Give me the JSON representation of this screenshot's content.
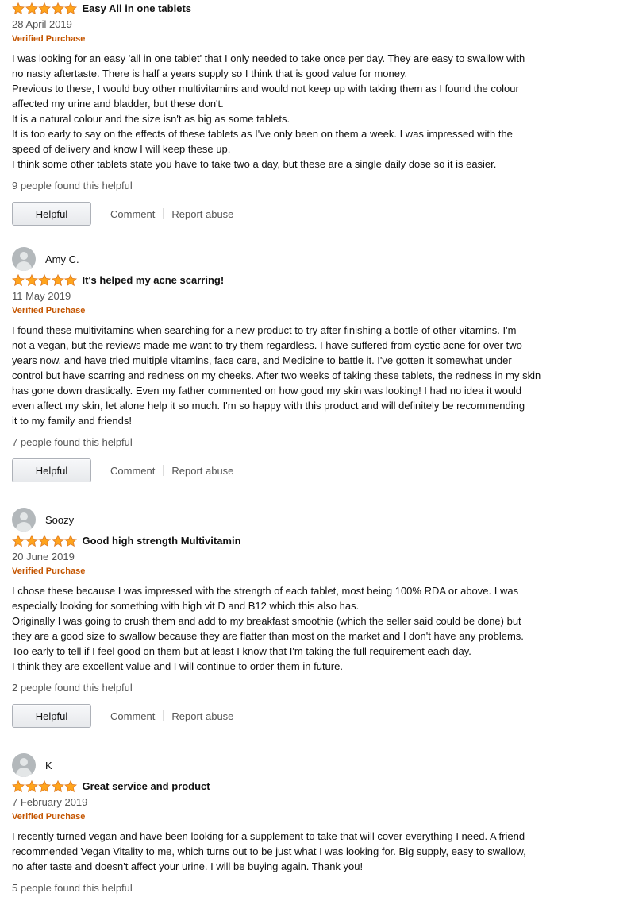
{
  "colors": {
    "star": "#ffa41c",
    "star_stroke": "#de7921",
    "verified": "#c45500"
  },
  "reviews": [
    {
      "author": "",
      "rating": 5,
      "title": "Easy All in one tablets",
      "date": "28 April 2019",
      "verified": "Verified Purchase",
      "lines": [
        "I was looking for an easy 'all in one tablet' that I only needed to take once per day. They are easy to swallow with",
        "no nasty aftertaste. There is half a years supply so I think that is good value for money.",
        "Previous to these, I would buy other multivitamins and would not keep up with taking them as I found the colour",
        "affected my urine and bladder, but these don't.",
        "It is a natural colour and the size isn't as big as some tablets.",
        "It is too early to say on the effects of these tablets as I've only been on them a week. I was impressed with the",
        "speed of delivery and know I will keep these up.",
        "I think some other tablets state you have to take two a day, but these are a single daily dose so it is easier."
      ],
      "helpful_count": "9 people found this helpful",
      "helpful_label": "Helpful",
      "comment_label": "Comment",
      "report_label": "Report abuse"
    },
    {
      "author": "Amy C.",
      "rating": 5,
      "title": "It's helped my acne scarring!",
      "date": "11 May 2019",
      "verified": "Verified Purchase",
      "lines": [
        "I found these multivitamins when searching for a new product to try after finishing a bottle of other vitamins. I'm",
        "not a vegan, but the reviews made me want to try them regardless. I have suffered from cystic acne for over two",
        "years now, and have tried multiple vitamins, face care, and Medicine to battle it. I've gotten it somewhat under",
        "control but have scarring and redness on my cheeks. After two weeks of taking these tablets, the redness in my skin",
        "has gone down drastically. Even my father commented on how good my skin was looking! I had no idea it would",
        "even affect my skin, let alone help it so much. I'm so happy with this product and will definitely be recommending",
        "it to my family and friends!"
      ],
      "helpful_count": "7 people found this helpful",
      "helpful_label": "Helpful",
      "comment_label": "Comment",
      "report_label": "Report abuse"
    },
    {
      "author": "Soozy",
      "rating": 5,
      "title": "Good high strength Multivitamin",
      "date": "20 June 2019",
      "verified": "Verified Purchase",
      "lines": [
        "I chose these because I was impressed with the strength of each tablet, most being 100% RDA or above. I was",
        "especially looking for something with high vit D and B12 which this also has.",
        "Originally I was going to crush them and add to my breakfast smoothie (which the seller said could be done) but",
        "they are a good size to swallow because they are flatter than most on the market and I don't have any problems.",
        "Too early to tell if I feel good on them but at least I know that I'm taking the full requirement each day.",
        "I think they are excellent value and I will continue to order them in future."
      ],
      "helpful_count": "2 people found this helpful",
      "helpful_label": "Helpful",
      "comment_label": "Comment",
      "report_label": "Report abuse"
    },
    {
      "author": "K",
      "rating": 5,
      "title": "Great service and product",
      "date": "7 February 2019",
      "verified": "Verified Purchase",
      "lines": [
        "I recently turned vegan and have been looking for a supplement to take that will cover everything I need. A friend",
        "recommended Vegan Vitality to me, which turns out to be just what I was looking for. Big supply, easy to swallow,",
        "no after taste and doesn't affect your urine. I will be buying again. Thank you!"
      ],
      "helpful_count": "5 people found this helpful",
      "helpful_label": "",
      "comment_label": "",
      "report_label": ""
    }
  ]
}
